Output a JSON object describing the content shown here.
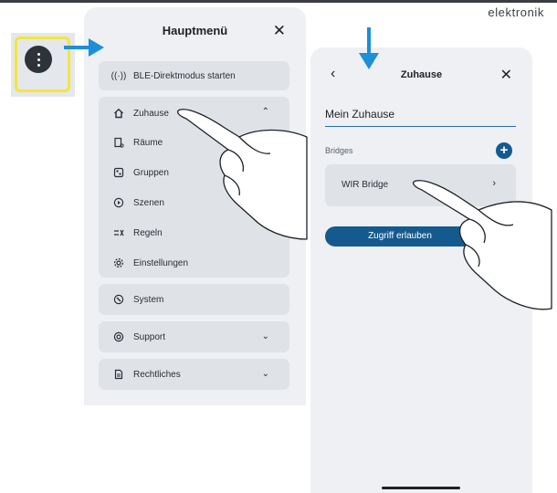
{
  "brand": "elektronik",
  "menu": {
    "title": "Hauptmenü",
    "close_glyph": "✕",
    "ble_label": "BLE-Direktmodus starten",
    "home_group": {
      "label": "Zuhause",
      "items": [
        {
          "label": "Räume",
          "icon": "rooms-icon"
        },
        {
          "label": "Gruppen",
          "icon": "groups-icon"
        },
        {
          "label": "Szenen",
          "icon": "scenes-icon"
        },
        {
          "label": "Regeln",
          "icon": "rules-icon"
        },
        {
          "label": "Einstellungen",
          "icon": "settings-icon"
        }
      ]
    },
    "system_label": "System",
    "support_label": "Support",
    "legal_label": "Rechtliches"
  },
  "home": {
    "back_glyph": "‹",
    "title": "Zuhause",
    "close_glyph": "✕",
    "name_value": "Mein Zuhause",
    "bridges_label": "Bridges",
    "plus_glyph": "+",
    "bridge_name": "WIR Bridge",
    "bridge_chev": "›",
    "grant_label": "Zugriff erlauben"
  },
  "colors": {
    "accent": "#155a8f",
    "highlight": "#f3e63a",
    "arrow": "#1e8ed8",
    "card": "#dfe2e6",
    "panel": "#eef0f3"
  }
}
